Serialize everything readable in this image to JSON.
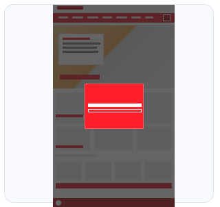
{
  "page": {
    "background": "#ffffff",
    "frame_color": "#f7f9fc"
  },
  "site": {
    "brand_color": "#e21a22",
    "nav_items": [
      "",
      "",
      "",
      "",
      "",
      "",
      ""
    ],
    "hero_title": "",
    "hero_button": "",
    "section_title": "",
    "chat_label": ""
  },
  "consent_dialog": {
    "body_text": "",
    "accept_label": "",
    "settings_label": "",
    "reject_label": "",
    "privacy_link": "",
    "more_link": ""
  },
  "icons": [
    "chat-icon"
  ]
}
